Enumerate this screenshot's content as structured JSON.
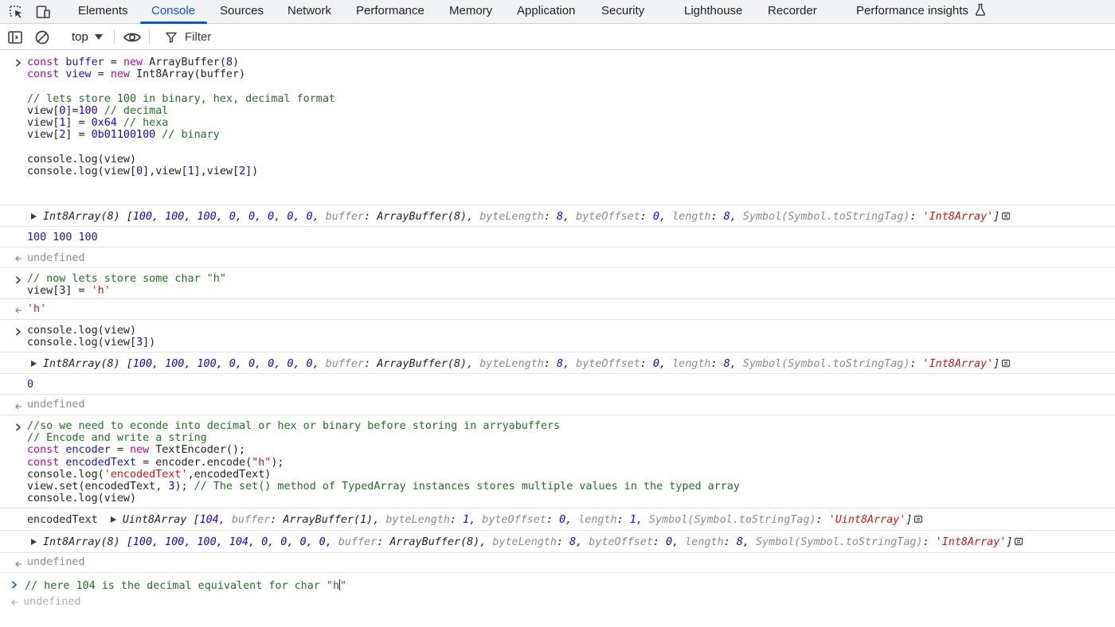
{
  "tabs": [
    {
      "label": "Elements"
    },
    {
      "label": "Console"
    },
    {
      "label": "Sources"
    },
    {
      "label": "Network"
    },
    {
      "label": "Performance"
    },
    {
      "label": "Memory"
    },
    {
      "label": "Application"
    },
    {
      "label": "Security"
    },
    {
      "label": "Lighthouse"
    },
    {
      "label": "Recorder"
    },
    {
      "label": "Performance insights"
    }
  ],
  "active_tab": "Console",
  "toolbar": {
    "context": "top",
    "filter_placeholder": "Filter"
  },
  "console": {
    "entry1": {
      "l1": {
        "a": "const",
        "b": " buffer",
        "c": " = ",
        "d": "new",
        "e": " ArrayBuffer(",
        "f": "8",
        "g": ")"
      },
      "l2": {
        "a": "const",
        "b": " view",
        "c": " = ",
        "d": "new",
        "e": " Int8Array(buffer)"
      },
      "l4": "// lets store 100 in binary, hex, decimal format",
      "l5": {
        "a": "view[",
        "b": "0",
        "c": "]=",
        "d": "100",
        "e": " // decimal"
      },
      "l6": {
        "a": "view[",
        "b": "1",
        "c": "] = ",
        "d": "0x64",
        "e": " // hexa"
      },
      "l7": {
        "a": "view[",
        "b": "2",
        "c": "] = ",
        "d": "0b01100100",
        "e": " // binary"
      },
      "l9": "console.log(view)",
      "l10": {
        "a": "console.log(view[",
        "b": "0",
        "c": "],view[",
        "d": "1",
        "e": "],view[",
        "f": "2",
        "g": "])"
      }
    },
    "out1": {
      "head": "Int8Array(8) [",
      "vals": "100, 100, 100, 0, 0, 0, 0, 0,",
      "k1": " buffer",
      "v1": ": ArrayBuffer(8),",
      "k2": " byteLength",
      "v2a": ": ",
      "v2": "8",
      "v2b": ",",
      "k3": " byteOffset",
      "v3a": ": ",
      "v3": "0",
      "v3b": ",",
      "k4": " length",
      "v4a": ": ",
      "v4": "8",
      "v4b": ",",
      "k5": " Symbol(Symbol.toStringTag)",
      "v5a": ": ",
      "v5": "'Int8Array'",
      "end": "]"
    },
    "out2": "100 100 100",
    "undef1": "undefined",
    "entry2": {
      "l1": "// now lets store some char \"h\"",
      "l2": {
        "a": "view[",
        "b": "3",
        "c": "] = ",
        "d": "'h'"
      }
    },
    "ret2": "'h'",
    "entry3": {
      "l1": "console.log(view)",
      "l2": {
        "a": "console.log(view[",
        "b": "3",
        "c": "])"
      }
    },
    "out3": {
      "head": "Int8Array(8) [",
      "vals": "100, 100, 100, 0, 0, 0, 0, 0,",
      "k1": " buffer",
      "v1": ": ArrayBuffer(8),",
      "k2": " byteLength",
      "v2a": ": ",
      "v2": "8",
      "v2b": ",",
      "k3": " byteOffset",
      "v3a": ": ",
      "v3": "0",
      "v3b": ",",
      "k4": " length",
      "v4a": ": ",
      "v4": "8",
      "v4b": ",",
      "k5": " Symbol(Symbol.toStringTag)",
      "v5a": ": ",
      "v5": "'Int8Array'",
      "end": "]"
    },
    "out4": "0",
    "undef2": "undefined",
    "entry4": {
      "l1": "//so we need to econde into decimal or hex or binary before storing in arryabuffers",
      "l2": "// Encode and write a string",
      "l3": {
        "a": "const",
        "b": " encoder",
        "c": " = ",
        "d": "new",
        "e": " TextEncoder();"
      },
      "l4": {
        "a": "const",
        "b": " encodedText",
        "c": " = encoder.encode(",
        "d": "\"h\"",
        "e": ");"
      },
      "l5": {
        "a": "console.log(",
        "b": "'encodedText'",
        "c": ",encodedText)"
      },
      "l6": {
        "a": "view.set(encodedText, ",
        "b": "3",
        "c": "); ",
        "d": "// The set() method of TypedArray instances stores multiple values in the typed array"
      },
      "l7": "console.log(view)"
    },
    "out5": {
      "label": "encodedText",
      "head": "Uint8Array [",
      "vals": "104,",
      "k1": " buffer",
      "v1": ": ArrayBuffer(1),",
      "k2": " byteLength",
      "v2a": ": ",
      "v2": "1",
      "v2b": ",",
      "k3": " byteOffset",
      "v3a": ": ",
      "v3": "0",
      "v3b": ",",
      "k4": " length",
      "v4a": ": ",
      "v4": "1",
      "v4b": ",",
      "k5": " Symbol(Symbol.toStringTag)",
      "v5a": ": ",
      "v5": "'Uint8Array'",
      "end": "]"
    },
    "out6": {
      "head": "Int8Array(8) [",
      "vals": "100, 100, 100, 104, 0, 0, 0, 0,",
      "k1": " buffer",
      "v1": ": ArrayBuffer(8),",
      "k2": " byteLength",
      "v2a": ": ",
      "v2": "8",
      "v2b": ",",
      "k3": " byteOffset",
      "v3a": ": ",
      "v3": "0",
      "v3b": ",",
      "k4": " length",
      "v4a": ": ",
      "v4": "8",
      "v4b": ",",
      "k5": " Symbol(Symbol.toStringTag)",
      "v5a": ": ",
      "v5": "'Int8Array'",
      "end": "]"
    },
    "undef3": "undefined",
    "input": {
      "before": "// here 104 is the decimal equivalent for char \"h",
      "after": "\""
    },
    "preview": "undefined"
  }
}
